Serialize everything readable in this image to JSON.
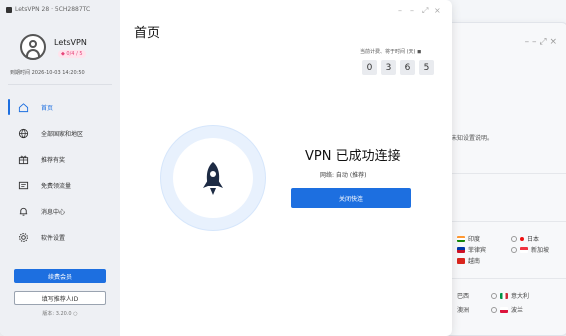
{
  "window": {
    "title": "LetsVPN 28 · 5CH2887TC",
    "controls": [
      "–",
      "–",
      "⤢",
      "×"
    ]
  },
  "user": {
    "name": "LetsVPN",
    "badge": "◆ 0/4 / 5",
    "expiry": "到期时间 2026-10-03 14:20:50"
  },
  "nav": {
    "items": [
      {
        "label": "首页",
        "icon": "home-icon",
        "active": true
      },
      {
        "label": "全部国家和地区",
        "icon": "globe-icon",
        "active": false
      },
      {
        "label": "推荐有奖",
        "icon": "gift-icon",
        "active": false
      },
      {
        "label": "免费领流量",
        "icon": "ticket-icon",
        "active": false
      },
      {
        "label": "消息中心",
        "icon": "bell-icon",
        "active": false
      },
      {
        "label": "软件设置",
        "icon": "gear-icon",
        "active": false
      }
    ]
  },
  "sidebar_buttons": {
    "renew": "续费会员",
    "invite": "填写推荐人ID",
    "version": "版本: 3.20.0 ○"
  },
  "main": {
    "title": "首页",
    "speed_label": "当前计费、将于时间 (天) ◼",
    "speed_digits": [
      "0",
      "3",
      "6",
      "5"
    ],
    "status": "VPN 已成功连接",
    "network": "网络: 自动 (推荐)",
    "disconnect": "关闭快连"
  },
  "background_window": {
    "desc": "未知设置说明。",
    "regions": [
      {
        "label": "印度",
        "color": "#ff9933"
      },
      {
        "label": "菲律宾",
        "color": "#0038a8"
      },
      {
        "label": "越南",
        "color": "#da251d"
      }
    ],
    "regions_right": [
      {
        "label": "日本",
        "color": "#bc002d"
      },
      {
        "label": "新加坡",
        "color": "#ef3340"
      }
    ],
    "bottom_left": [
      "巴西",
      "澳洲"
    ],
    "bottom_right": [
      {
        "label": "意大利",
        "color": "#009246"
      },
      {
        "label": "波兰",
        "color": "#dc143c"
      }
    ]
  }
}
